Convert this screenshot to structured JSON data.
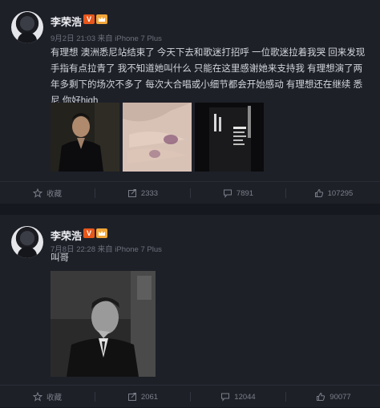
{
  "posts": [
    {
      "username": "李荣浩",
      "verified_badge": "V",
      "meta": "9月2日 21:03 来自 iPhone 7 Plus",
      "text": "有理想 澳洲悉尼站结束了 今天下去和歌迷打招呼 一位歌迷拉着我哭 回来发现手指有点拉青了 我不知道她叫什么 只能在这里感谢她来支持我 有理想演了两年多剩下的场次不多了 每次大合唱或小细节都会开始感动 有理想还在继续 悉尼 你好high",
      "actions": {
        "favorite": "收藏",
        "repost": "2333",
        "comment": "7891",
        "like": "107295"
      }
    },
    {
      "username": "李荣浩",
      "verified_badge": "V",
      "meta": "7月8日 22:28 来自 iPhone 7 Plus",
      "text": "叫哥",
      "actions": {
        "favorite": "收藏",
        "repost": "2061",
        "comment": "12044",
        "like": "90077"
      }
    }
  ],
  "colors": {
    "page": "#16181f",
    "card": "#1e2028",
    "accent": "#e8571a",
    "meta": "#6d717b"
  }
}
